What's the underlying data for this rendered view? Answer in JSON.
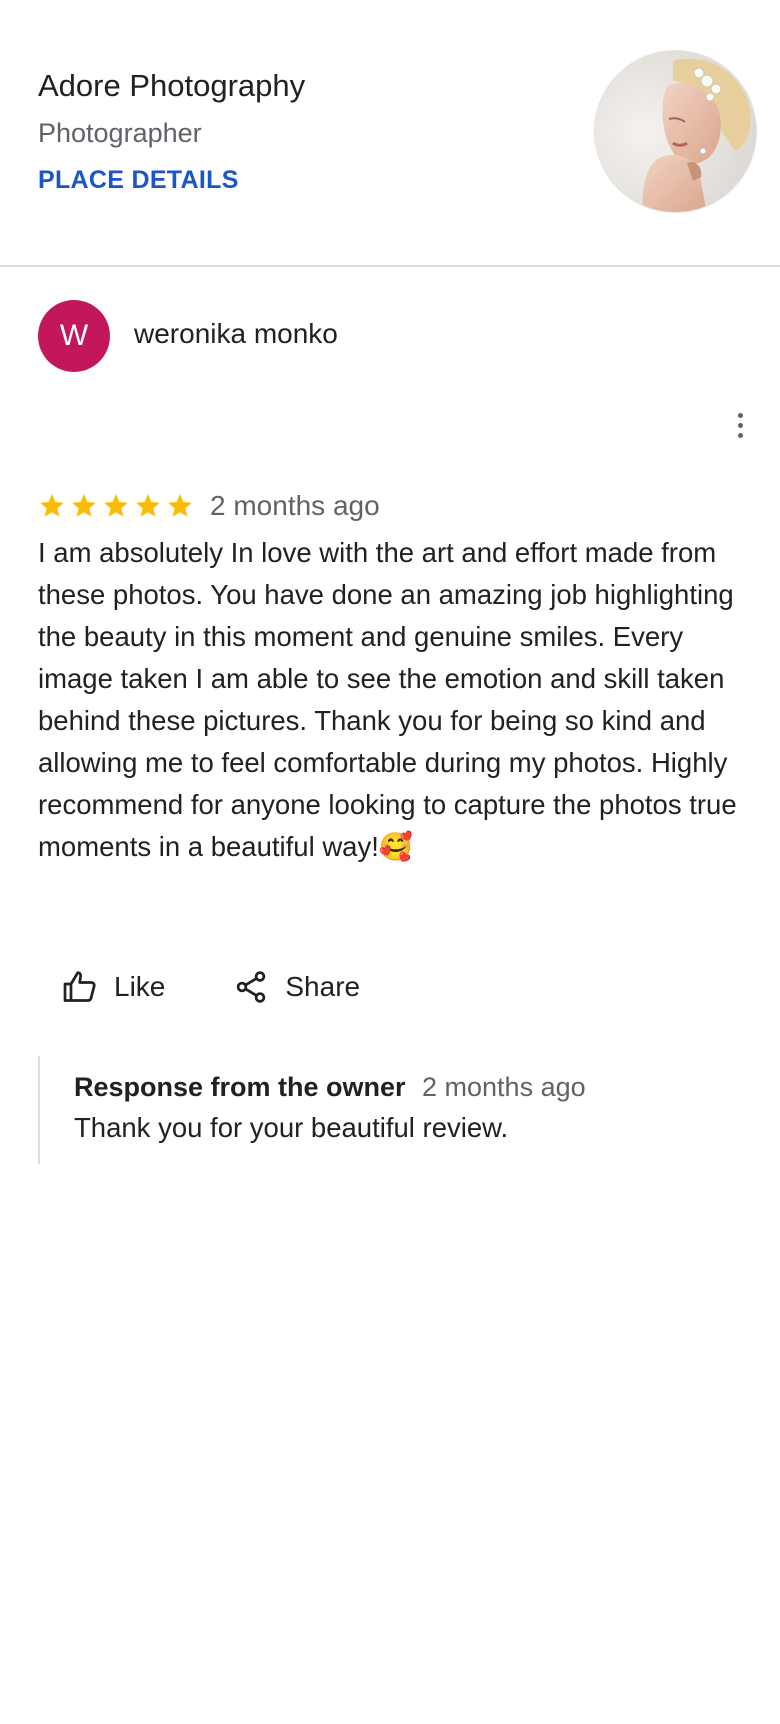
{
  "place": {
    "name": "Adore Photography",
    "category": "Photographer",
    "details_link": "PLACE DETAILS"
  },
  "review": {
    "reviewer_initial": "W",
    "reviewer_name": "weronika monko",
    "rating": 5,
    "date": "2 months ago",
    "text": "I am absolutely In love with the art and effort made from these photos. You have done an amazing job highlighting the beauty in this moment and genuine smiles. Every image taken I am able to see the emotion and skill taken behind these pictures. Thank you for being so kind and allowing me to feel comfortable during my photos. Highly recommend for anyone looking to capture the photos true moments in a beautiful way!🥰"
  },
  "actions": {
    "like_label": "Like",
    "share_label": "Share"
  },
  "owner_response": {
    "label": "Response from the owner",
    "date": "2 months ago",
    "text": "Thank you for your beautiful review."
  },
  "colors": {
    "accent_link": "#1a56c8",
    "avatar_bg": "#c2185b",
    "star": "#fbbc04",
    "secondary_text": "#5f6368"
  },
  "icons": {
    "like": "thumb-up-icon",
    "share": "share-icon",
    "more": "more-vert-icon",
    "star": "star-icon"
  }
}
